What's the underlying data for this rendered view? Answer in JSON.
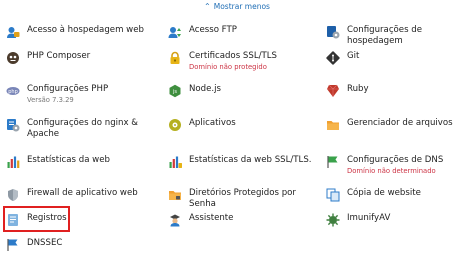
{
  "toggle": {
    "label": "Mostrar menos"
  },
  "items": [
    {
      "label": "Acesso à hospedagem web",
      "icon": "web-hosting-icon"
    },
    {
      "label": "Acesso FTP",
      "icon": "ftp-icon"
    },
    {
      "label": "Configurações de hospedagem",
      "icon": "hosting-settings-icon"
    },
    {
      "label": "PHP Composer",
      "icon": "php-composer-icon"
    },
    {
      "label": "Certificados SSL/TLS",
      "sub": "Domínio não protegido",
      "icon": "ssl-lock-icon"
    },
    {
      "label": "Git",
      "icon": "git-icon"
    },
    {
      "label": "Configurações PHP",
      "sub": "Versão 7.3.29",
      "icon": "php-icon"
    },
    {
      "label": "Node.js",
      "icon": "nodejs-icon"
    },
    {
      "label": "Ruby",
      "icon": "ruby-icon"
    },
    {
      "label": "Configurações do nginx & Apache",
      "icon": "server-settings-icon"
    },
    {
      "label": "Aplicativos",
      "icon": "applications-icon"
    },
    {
      "label": "Gerenciador de arquivos",
      "icon": "folder-icon"
    },
    {
      "label": "Estatísticas da web",
      "icon": "web-stats-icon"
    },
    {
      "label": "Estatísticas da web SSL/TLS.",
      "icon": "ssl-stats-icon"
    },
    {
      "label": "Configurações de DNS",
      "sub": "Domínio não determinado",
      "icon": "dns-flag-icon"
    },
    {
      "label": "Firewall de aplicativo web",
      "icon": "firewall-shield-icon"
    },
    {
      "label": "Diretórios Protegidos por Senha",
      "icon": "protected-folder-icon"
    },
    {
      "label": "Cópia de website",
      "icon": "copy-website-icon"
    },
    {
      "label": "Registros",
      "icon": "logs-icon"
    },
    {
      "label": "Assistente",
      "icon": "assistant-icon"
    },
    {
      "label": "ImunifyAV",
      "icon": "imunifyav-icon"
    },
    {
      "label": "DNSSEC",
      "icon": "dnssec-icon"
    }
  ]
}
